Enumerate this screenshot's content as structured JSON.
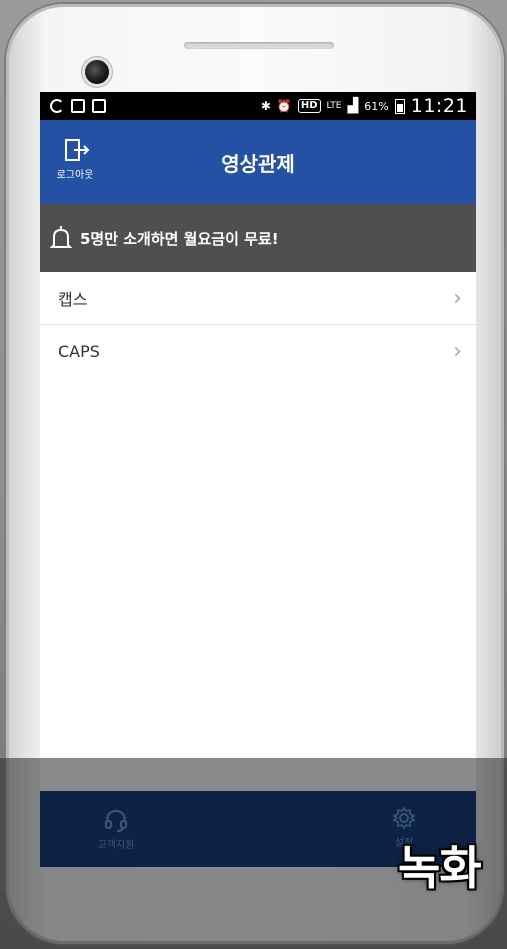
{
  "status_bar": {
    "battery": "61%",
    "network": "LTE",
    "hd": "HD",
    "time": "11:21"
  },
  "app_bar": {
    "logout_label": "로그아웃",
    "title": "영상관제"
  },
  "banner": {
    "text": "5명만 소개하면 월요금이 무료!"
  },
  "list": {
    "items": [
      {
        "label": "캡스"
      },
      {
        "label": "CAPS"
      }
    ]
  },
  "bottom_nav": {
    "support_label": "고객지원",
    "settings_label": "설정"
  },
  "overlay_caption": "녹화",
  "colors": {
    "app_bar": "#2451a4",
    "banner": "#4f4f4f",
    "bottom_nav": "#0d2244"
  }
}
